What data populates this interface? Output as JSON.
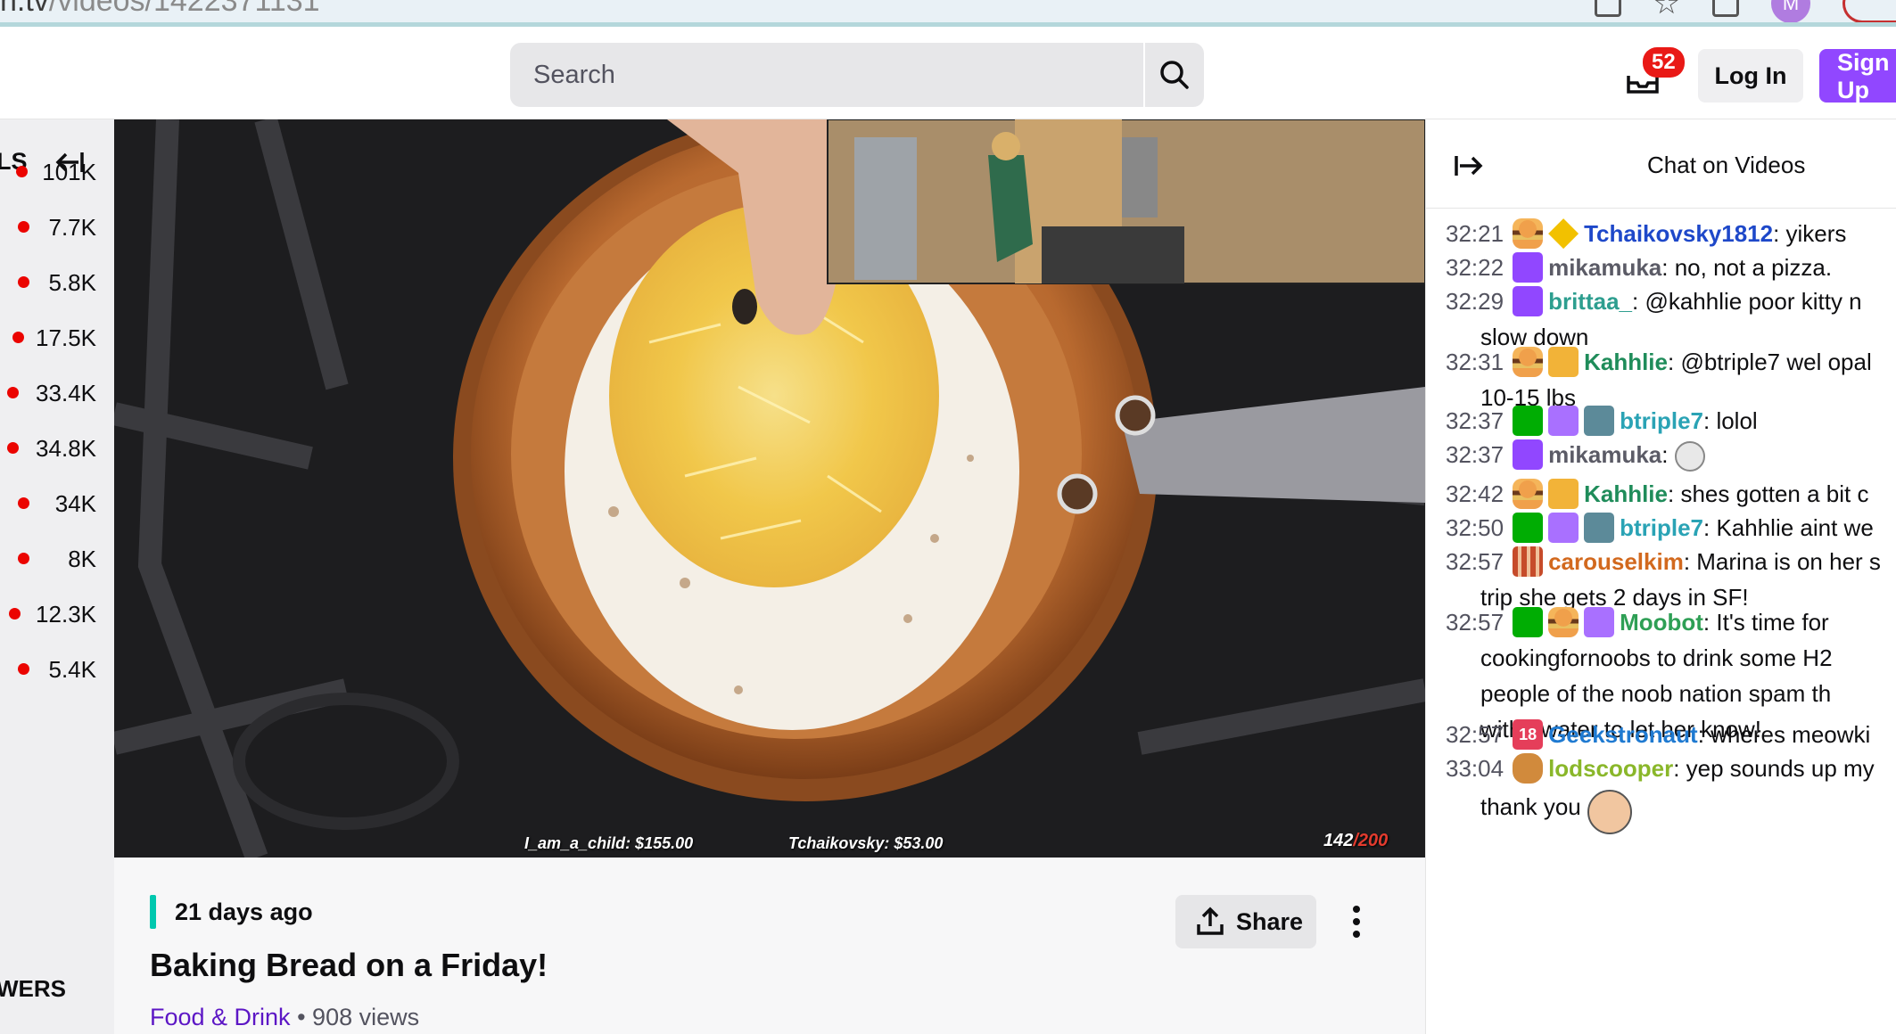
{
  "browser": {
    "url_prefix": "n.tv",
    "url_rest": "/videos/1422371131",
    "profile_initial": "M"
  },
  "topnav": {
    "search_placeholder": "Search",
    "notification_count": "52",
    "login_label": "Log In",
    "signup_label": "Sign Up"
  },
  "sidebar": {
    "header_label": "LS",
    "items": [
      {
        "count": "101K"
      },
      {
        "count": "7.7K"
      },
      {
        "count": "5.8K"
      },
      {
        "count": "17.5K"
      },
      {
        "count": "33.4K"
      },
      {
        "count": "34.8K"
      },
      {
        "count": "34K"
      },
      {
        "count": "8K"
      },
      {
        "count": "12.3K"
      },
      {
        "count": "5.4K"
      }
    ],
    "footer_label": "WERS"
  },
  "video": {
    "donation_left": "I_am_a_child: $155.00",
    "donation_right": "Tchaikovsky: $53.00",
    "counter_current": "142",
    "counter_total": "/200"
  },
  "meta": {
    "ago": "21 days ago",
    "share_label": "Share",
    "title": "Baking Bread on a Friday!",
    "category": "Food & Drink",
    "separator": "•",
    "views": "908 views"
  },
  "chat": {
    "title": "Chat on Videos",
    "messages": [
      {
        "ts": "32:21",
        "user": "Tchaikovsky1812",
        "color": "#1e48c9",
        "text": ": yikers"
      },
      {
        "ts": "32:22",
        "user": "mikamuka",
        "color": "#5b5b66",
        "text": ": no, not a pizza."
      },
      {
        "ts": "32:29",
        "user": "brittaa_",
        "color": "#2d9e8f",
        "text": ": @kahhlie poor kitty n",
        "text2": "slow down"
      },
      {
        "ts": "32:31",
        "user": "Kahhlie",
        "color": "#1f8c5a",
        "text": ": @btriple7 wel opal",
        "text2": "10-15 lbs"
      },
      {
        "ts": "32:37",
        "user": "btriple7",
        "color": "#2aa3b5",
        "text": ": lolol"
      },
      {
        "ts": "32:37",
        "user": "mikamuka",
        "color": "#5b5b66",
        "text": ":"
      },
      {
        "ts": "32:42",
        "user": "Kahhlie",
        "color": "#1f8c5a",
        "text": ": shes gotten a bit c"
      },
      {
        "ts": "32:50",
        "user": "btriple7",
        "color": "#2aa3b5",
        "text": ": Kahhlie aint we"
      },
      {
        "ts": "32:57",
        "user": "carouselkim",
        "color": "#d2691e",
        "text": ": Marina is on her s",
        "text2": "trip she gets 2 days in SF!"
      },
      {
        "ts": "32:57",
        "user": "Moobot",
        "color": "#2e9f55",
        "text": ": It's time for",
        "text2": "cookingfornoobs to drink some H2",
        "text3": "people of the noob nation spam th",
        "text4": "with #water to let her know!"
      },
      {
        "ts": "32:57",
        "user": "Geekstronaut",
        "color": "#1f7ad1",
        "text": ": wheres meowki"
      },
      {
        "ts": "33:04",
        "user": "lodscooper",
        "color": "#8ab72a",
        "text": ": yep sounds up my",
        "text2": "thank you"
      }
    ]
  },
  "colors": {
    "accent_purple": "#9147ff",
    "live_red": "#eb0400",
    "category_link": "#5c16c5",
    "teal_accent": "#00c8af"
  }
}
